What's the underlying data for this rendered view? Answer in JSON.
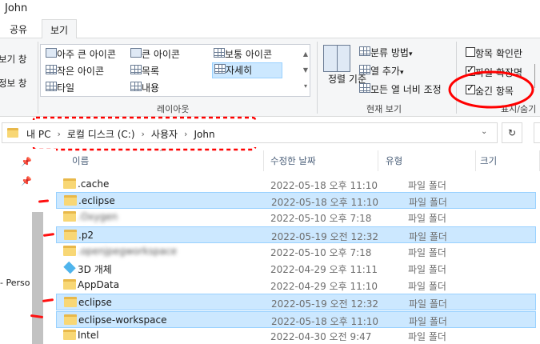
{
  "window": {
    "title": "John"
  },
  "tabs": [
    "공유",
    "보기"
  ],
  "ribbon": {
    "left_cut": [
      "보기 창",
      "정보 창"
    ],
    "layout": {
      "items": [
        "아주 큰 아이콘",
        "큰 아이콘",
        "보통 아이콘",
        "작은 아이콘",
        "목록",
        "자세히",
        "타일",
        "내용"
      ],
      "selected": "자세히",
      "label": "레이아웃"
    },
    "current_view": {
      "sort_label_1": "정렬",
      "sort_label_2": "기준",
      "group_by": "분류 방법",
      "add_column": "열 추가",
      "fit_columns": "모든 열 너비 조정",
      "label": "현재 보기"
    },
    "show_hide": {
      "item_checkboxes": {
        "label": "항목 확인란",
        "checked": false
      },
      "file_extensions": {
        "label": "파일 확장명",
        "checked": true
      },
      "hidden_items": {
        "label": "숨긴 항목",
        "checked": true
      },
      "label": "표시/숨기"
    }
  },
  "address": {
    "crumbs": [
      "내 PC",
      "로컬 디스크 (C:)",
      "사용자",
      "John"
    ],
    "refresh_icon": "refresh-icon"
  },
  "nav": {
    "truncated_item": "- Perso"
  },
  "columns": {
    "name": "이름",
    "modified": "수정한 날짜",
    "type": "유형",
    "size": "크기"
  },
  "files": [
    {
      "name": ".cache",
      "date": "2022-05-18 오후 11:10",
      "type": "파일 폴더",
      "icon": "folder-icon",
      "selected": false,
      "blurred": false
    },
    {
      "name": ".eclipse",
      "date": "2022-05-18 오후 11:10",
      "type": "파일 폴더",
      "icon": "folder-icon",
      "selected": true,
      "blurred": false
    },
    {
      "name": ".Oxygen",
      "date": "2022-05-10 오후 7:18",
      "type": "파일 폴더",
      "icon": "folder-icon",
      "selected": false,
      "blurred": true
    },
    {
      "name": ".p2",
      "date": "2022-05-19 오전 12:32",
      "type": "파일 폴더",
      "icon": "folder-icon",
      "selected": true,
      "blurred": false
    },
    {
      "name": ".openjpegworkspace",
      "date": "2022-05-10 오후 7:18",
      "type": "파일 폴더",
      "icon": "folder-icon",
      "selected": false,
      "blurred": true
    },
    {
      "name": "3D 개체",
      "date": "2022-04-29 오후 11:11",
      "type": "파일 폴더",
      "icon": "3d-objects-icon",
      "selected": false,
      "blurred": false
    },
    {
      "name": "AppData",
      "date": "2022-04-29 오후 11:10",
      "type": "파일 폴더",
      "icon": "folder-icon",
      "selected": false,
      "blurred": false
    },
    {
      "name": "eclipse",
      "date": "2022-05-19 오전 12:32",
      "type": "파일 폴더",
      "icon": "folder-icon",
      "selected": true,
      "blurred": false
    },
    {
      "name": "eclipse-workspace",
      "date": "2022-05-18 오후 11:10",
      "type": "파일 폴더",
      "icon": "folder-icon",
      "selected": true,
      "blurred": false
    },
    {
      "name": "Intel",
      "date": "2022-04-30 오전 9:47",
      "type": "파일 폴더",
      "icon": "folder-icon",
      "selected": false,
      "blurred": false
    }
  ],
  "colors": {
    "selection": "#cce8ff",
    "selection_border": "#99d1ff",
    "annotation": "#ff0000"
  }
}
